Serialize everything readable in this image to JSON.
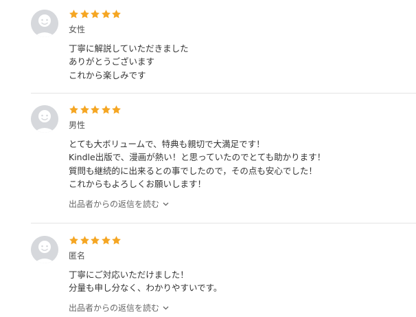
{
  "reviews": [
    {
      "rating": 5,
      "gender": "女性",
      "comment": "丁寧に解説していただきました\nありがとうございます\nこれから楽しみです",
      "reply_link": ""
    },
    {
      "rating": 5,
      "gender": "男性",
      "comment": "とても大ボリュームで、特典も親切で大満足です！\nKindle出版で、漫画が熱い！と思っていたのでとても助かります！\n質問も継続的に出来るとの事でしたので，その点も安心でした！\nこれからもよろしくお願いします！",
      "reply_link": "出品者からの返信を読む"
    },
    {
      "rating": 5,
      "gender": "匿名",
      "comment": "丁寧にご対応いただけました！\n分量も申し分なく、わかりやすいです。",
      "reply_link": "出品者からの返信を読む"
    }
  ],
  "colors": {
    "star": "#F5A623",
    "avatar_bg": "#D6D8DC",
    "avatar_face": "#FFFFFF",
    "divider": "#E4E4E4"
  },
  "icons": {
    "star": "star-icon",
    "avatar": "user-avatar-icon",
    "chevron": "chevron-down-icon"
  }
}
